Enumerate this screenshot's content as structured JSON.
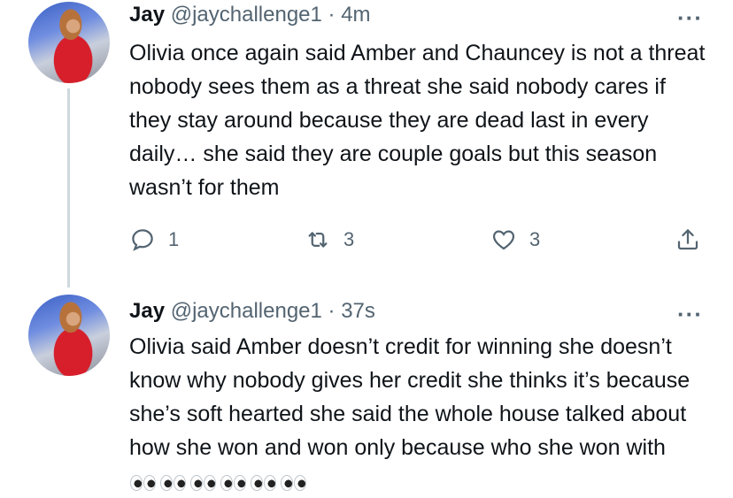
{
  "tweets": [
    {
      "name": "Jay",
      "handle": "@jaychallenge1",
      "separator": "·",
      "time": "4m",
      "more": "···",
      "text": "Olivia once again said Amber and Chauncey is not a threat nobody sees them as a threat she said nobody cares if they stay around because they are dead last in every daily… she said they are couple goals but this season wasn’t for them",
      "replies": "1",
      "retweets": "3",
      "likes": "3"
    },
    {
      "name": "Jay",
      "handle": "@jaychallenge1",
      "separator": "·",
      "time": "37s",
      "more": "···",
      "text": "Olivia said Amber doesn’t credit for winning she doesn’t know why nobody gives her credit she thinks it’s because she’s soft hearted she said the whole house talked about how she won and won only because who she won with",
      "emoji": "eyes",
      "emoji_count": 6
    }
  ],
  "colors": {
    "text": "#0f1419",
    "secondary": "#536471",
    "thread_line": "#cfd9de"
  }
}
